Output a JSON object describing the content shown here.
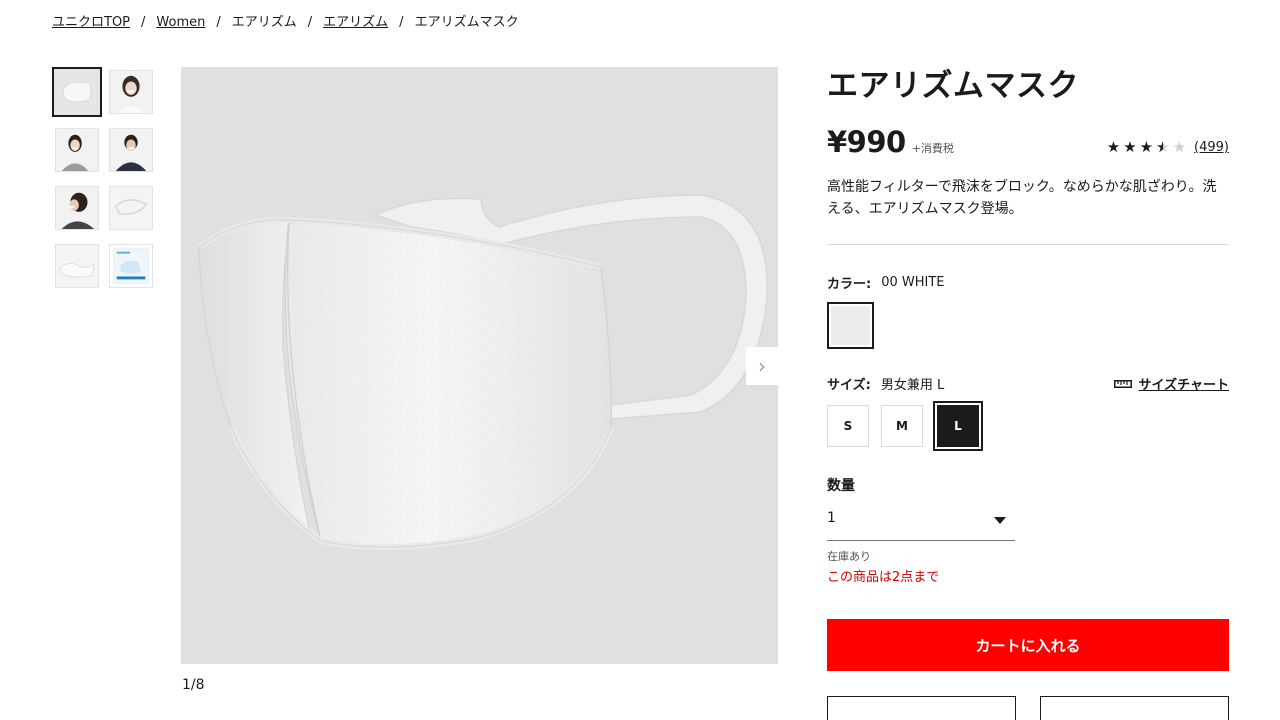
{
  "breadcrumb": {
    "items": [
      "ユニクロTOP",
      "Women",
      "エアリズム",
      "エアリズム"
    ],
    "current": "エアリズムマスク",
    "separator": "/"
  },
  "gallery": {
    "counter": "1/8",
    "next_arrow": "›"
  },
  "product": {
    "title": "エアリズムマスク",
    "price": "¥990",
    "tax_note": "+消費税",
    "rating": 3.5,
    "review_count": "(499)",
    "description": "高性能フィルターで飛沫をブロック。なめらかな肌ざわり。洗える、エアリズムマスク登場。"
  },
  "color": {
    "label": "カラー:",
    "value": "00 WHITE",
    "swatch_color": "#ececec"
  },
  "size": {
    "label": "サイズ:",
    "value": "男女兼用 L",
    "chart_label": "サイズチャート",
    "options": [
      "S",
      "M",
      "L"
    ],
    "selected": "L"
  },
  "quantity": {
    "label": "数量",
    "value": "1",
    "stock": "在庫あり",
    "limit": "この商品は2点まで"
  },
  "cart": {
    "label": "カートに入れる"
  },
  "colors": {
    "accent": "#ff0000",
    "warning": "#d10000",
    "text": "#1b1b1b"
  }
}
